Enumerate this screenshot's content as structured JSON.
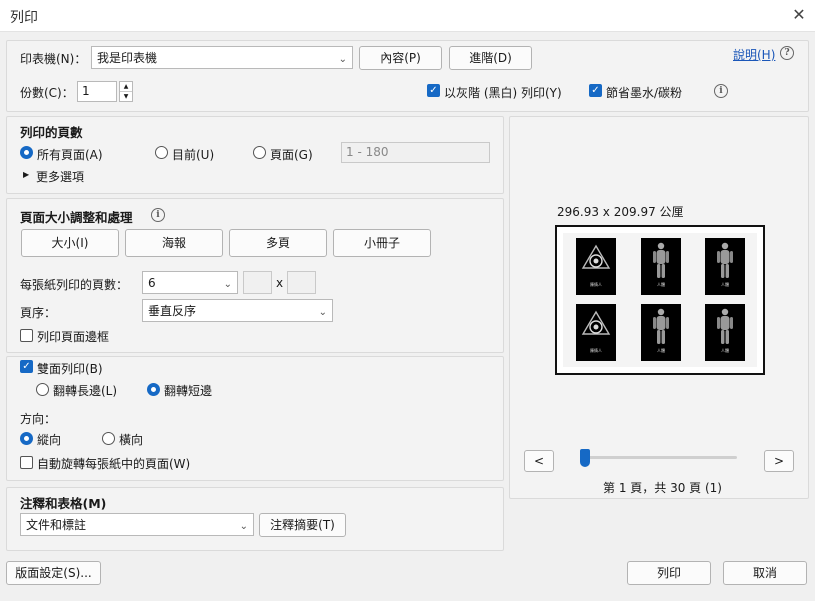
{
  "window": {
    "title": "列印",
    "close_glyph": "✕"
  },
  "top": {
    "printer_label": "印表機(N)：",
    "printer_value": "我是印表機",
    "properties_button": "內容(P)",
    "advanced_button": "進階(D)",
    "help_link": "說明(H)",
    "help_icon": "?",
    "copies_label": "份數(C)：",
    "copies_value": "1",
    "grayscale_label": "以灰階 (黑白) 列印(Y)",
    "grayscale_checked": true,
    "save_ink_label": "節省墨水/碳粉",
    "save_ink_checked": true,
    "info_icon": "i"
  },
  "pages_section": {
    "title": "列印的頁數",
    "all_pages": "所有頁面(A)",
    "current": "目前(U)",
    "pages": "頁面(G)",
    "range_placeholder": "1 - 180",
    "more_options": "更多選項",
    "selected": "all"
  },
  "sizing_section": {
    "title": "頁面大小調整和處理",
    "info_icon": "i",
    "tabs": [
      "大小(I)",
      "海報",
      "多頁",
      "小冊子"
    ],
    "pages_per_sheet_label": "每張紙列印的頁數：",
    "pages_per_sheet_value": "6",
    "times": "x",
    "page_order_label": "頁序：",
    "page_order_value": "垂直反序",
    "print_border_label": "列印頁面邊框",
    "print_border_checked": false
  },
  "duplex_section": {
    "duplex_label": "雙面列印(B)",
    "duplex_checked": true,
    "flip_long": "翻轉長邊(L)",
    "flip_short": "翻轉短邊",
    "flip_selected": "short",
    "orientation_label": "方向：",
    "portrait": "縱向",
    "landscape": "橫向",
    "orientation_selected": "portrait",
    "auto_rotate_label": "自動旋轉每張紙中的頁面(W)",
    "auto_rotate_checked": false
  },
  "comments_section": {
    "title": "注釋和表格(M)",
    "value": "文件和標註",
    "summary_button": "注釋摘要(T)"
  },
  "preview": {
    "dimensions": "296.93 x 209.97 公厘",
    "thumbnails": [
      {
        "kind": "logo",
        "caption": "陳情人"
      },
      {
        "kind": "figure",
        "caption": "人體"
      },
      {
        "kind": "figure",
        "caption": "人體"
      },
      {
        "kind": "logo",
        "caption": "陳情人"
      },
      {
        "kind": "figure",
        "caption": "人體"
      },
      {
        "kind": "figure",
        "caption": "人體"
      }
    ],
    "prev_button": "<",
    "next_button": ">",
    "page_status": "第 1 頁，共 30 頁 (1)",
    "slider_position": 0
  },
  "bottom": {
    "page_setup_button": "版面設定(S)...",
    "print_button": "列印",
    "cancel_button": "取消"
  },
  "colors": {
    "accent": "#1669c5",
    "link": "#1a56b8"
  }
}
